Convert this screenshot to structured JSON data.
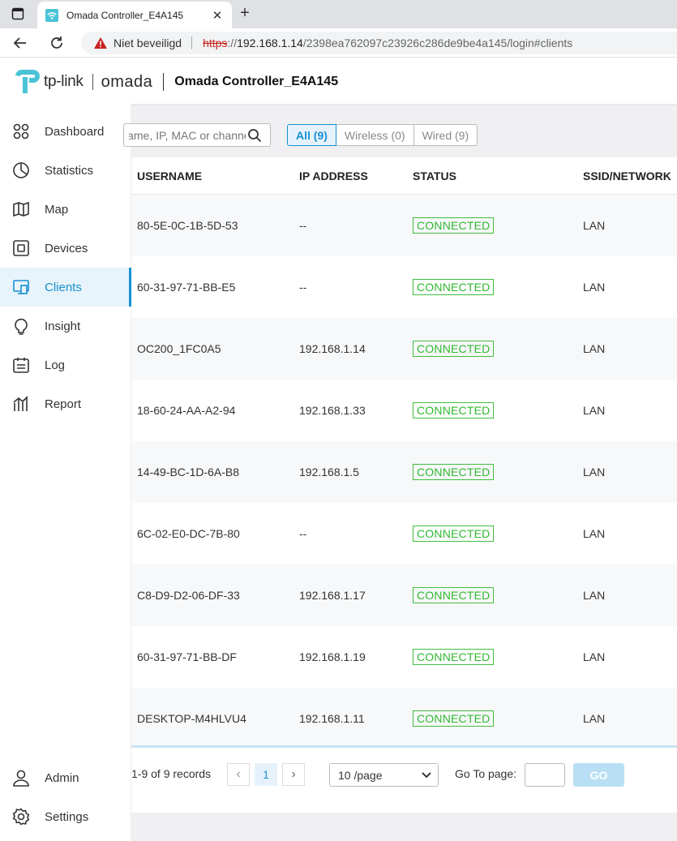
{
  "browser": {
    "tab_title": "Omada Controller_E4A145",
    "address": {
      "security_label": "Niet beveiligd",
      "scheme": "https",
      "scheme_sep": "://",
      "host": "192.168.1.14",
      "path": "/2398ea762097c23926c286de9be4a145/login#clients"
    }
  },
  "header": {
    "brand": "tp-link",
    "product": "omada",
    "controller_name": "Omada Controller_E4A145"
  },
  "sidebar": {
    "items": [
      {
        "label": "Dashboard",
        "icon": "dashboard-icon"
      },
      {
        "label": "Statistics",
        "icon": "pie-chart-icon"
      },
      {
        "label": "Map",
        "icon": "map-icon"
      },
      {
        "label": "Devices",
        "icon": "device-icon"
      },
      {
        "label": "Clients",
        "icon": "clients-icon",
        "active": true
      },
      {
        "label": "Insight",
        "icon": "lightbulb-icon"
      },
      {
        "label": "Log",
        "icon": "log-icon"
      },
      {
        "label": "Report",
        "icon": "report-icon"
      }
    ],
    "bottom_items": [
      {
        "label": "Admin",
        "icon": "user-icon"
      },
      {
        "label": "Settings",
        "icon": "gear-icon"
      }
    ]
  },
  "toolbar": {
    "search_placeholder": "Name, IP, MAC or channel",
    "filters": [
      "All (9)",
      "Wireless (0)",
      "Wired (9)"
    ],
    "active_filter": "All (9)"
  },
  "table": {
    "columns": [
      "USERNAME",
      "IP ADDRESS",
      "STATUS",
      "SSID/NETWORK"
    ],
    "rows": [
      {
        "username": "80-5E-0C-1B-5D-53",
        "ip": "--",
        "status": "CONNECTED",
        "network": "LAN"
      },
      {
        "username": "60-31-97-71-BB-E5",
        "ip": "--",
        "status": "CONNECTED",
        "network": "LAN"
      },
      {
        "username": "OC200_1FC0A5",
        "ip": "192.168.1.14",
        "status": "CONNECTED",
        "network": "LAN"
      },
      {
        "username": "18-60-24-AA-A2-94",
        "ip": "192.168.1.33",
        "status": "CONNECTED",
        "network": "LAN"
      },
      {
        "username": "14-49-BC-1D-6A-B8",
        "ip": "192.168.1.5",
        "status": "CONNECTED",
        "network": "LAN"
      },
      {
        "username": "6C-02-E0-DC-7B-80",
        "ip": "--",
        "status": "CONNECTED",
        "network": "LAN"
      },
      {
        "username": "C8-D9-D2-06-DF-33",
        "ip": "192.168.1.17",
        "status": "CONNECTED",
        "network": "LAN"
      },
      {
        "username": "60-31-97-71-BB-DF",
        "ip": "192.168.1.19",
        "status": "CONNECTED",
        "network": "LAN"
      },
      {
        "username": "DESKTOP-M4HLVU4",
        "ip": "192.168.1.11",
        "status": "CONNECTED",
        "network": "LAN"
      }
    ]
  },
  "pagination": {
    "records": "1-9 of 9 records",
    "current_page": "1",
    "page_size": "10 /page",
    "goto_label": "Go To page:",
    "go_label": "GO"
  },
  "colors": {
    "accent": "#1890d0",
    "connected": "#2fb82f",
    "warning": "#c5221f"
  }
}
